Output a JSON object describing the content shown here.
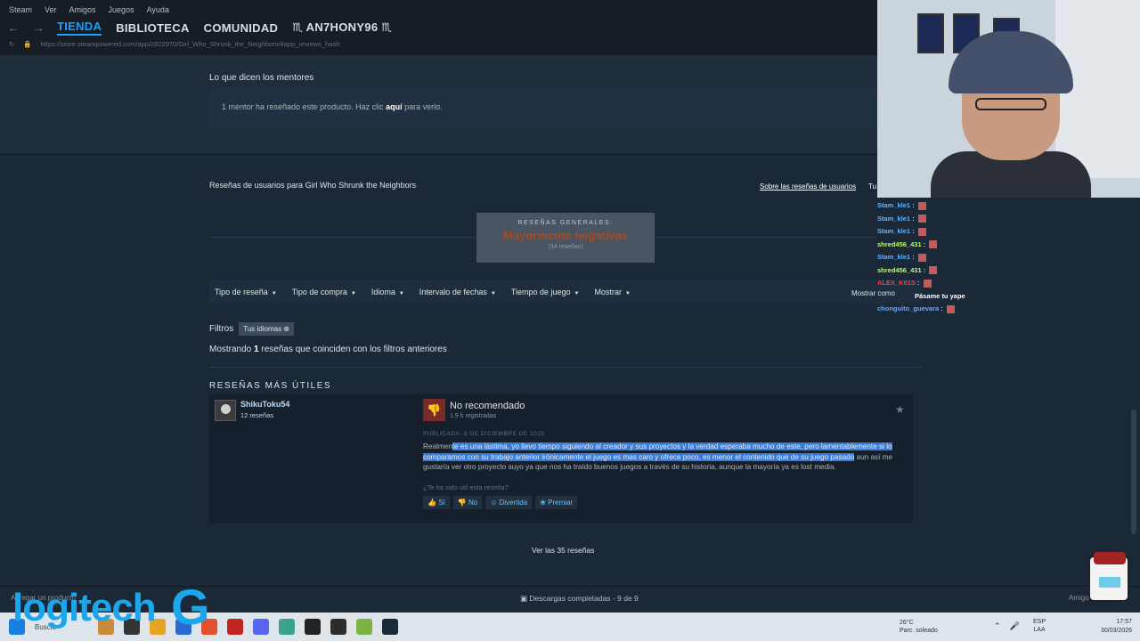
{
  "menubar": [
    "Steam",
    "Ver",
    "Amigos",
    "Juegos",
    "Ayuda"
  ],
  "nav": {
    "tabs": [
      "TIENDA",
      "BIBLIOTECA",
      "COMUNIDAD",
      "♏ AN7HONY96 ♏"
    ],
    "url": "https://store.steampowered.com/app/2822970/Girl_Who_Shrunk_the_Neighbors/#app_reviews_hash"
  },
  "mentors": {
    "title": "Lo que dicen los mentores",
    "text_before": "1 mentor ha reseñado este producto. Haz clic",
    "link": "aquí",
    "text_after": "para verlo."
  },
  "reviews": {
    "heading": "Reseñas de usuarios para Girl Who Shrunk the Neighbors",
    "about_link": "Sobre las reseñas de usuarios",
    "about_link2": "Tu",
    "summary_label": "RESEÑAS GENERALES:",
    "summary_value": "Mayormente negativas",
    "summary_count": "(34 reseñas)",
    "filters": [
      "Tipo de reseña",
      "Tipo de compra",
      "Idioma",
      "Intervalo de fechas",
      "Tiempo de juego",
      "Mostrar"
    ],
    "show_pref": "Mostrar como",
    "filtros_label": "Filtros",
    "filter_chip": "Tus idiomas",
    "showing_before": "Mostrando",
    "showing_count": "1",
    "showing_after": "reseñas que coinciden con los filtros anteriores",
    "most_helpful": "RESEÑAS MÁS ÚTILES",
    "see_all": "Ver las 35 reseñas"
  },
  "review": {
    "user": "ShikuToku54",
    "user_reviews": "12 reseñas",
    "verdict": "No recomendado",
    "hours": "1.9 h registradas",
    "posted": "PUBLICADA: 6 DE DICIEMBRE DE 2025",
    "text_plain_start": "Realmen",
    "text_highlight": "te es una lástima, yo llevo tiempo siguiendo al creador y sus proyectos y la verdad esperaba mucho de este, pero lamentablemente si lo comparamos con su trabajo anterior irónicamente el juego es mas caro y ofrece poco, es menor el contenido que de su juego pasado",
    "text_plain_end": " aun así me gustaría ver otro proyecto suyo ya que nos ha traído buenos juegos a través de su historia, aunque la mayoría ya es lost media.",
    "helpful_q": "¿Te ha sido útil esta reseña?",
    "votes": [
      "Sí",
      "No",
      "Divertida",
      "Premiar"
    ]
  },
  "footer": {
    "add_game": "Agregar un producto",
    "downloads": "Descargas completadas - 9 de 9",
    "friends": "Amigos"
  },
  "chat": [
    {
      "name": "Stam_kle1",
      "cls": "n1",
      "msg": ""
    },
    {
      "name": "Stam_kle1",
      "cls": "n1",
      "msg": ""
    },
    {
      "name": "Stam_kle1",
      "cls": "n1",
      "msg": ""
    },
    {
      "name": "shred456_431",
      "cls": "n2",
      "msg": ""
    },
    {
      "name": "Stam_kle1",
      "cls": "n1",
      "msg": ""
    },
    {
      "name": "shred456_431",
      "cls": "n2",
      "msg": ""
    },
    {
      "name": "ALEX_K01S",
      "cls": "n3",
      "msg": ""
    },
    {
      "name": "",
      "cls": "n1",
      "msg": "Pásame tu yape"
    },
    {
      "name": "chonguito_guevara",
      "cls": "n4",
      "msg": ""
    }
  ],
  "watermark": {
    "brand": "logitech",
    "g": "G"
  },
  "taskbar": {
    "search": "Buscar",
    "weather_temp": "26°C",
    "weather_desc": "Parc. soleado",
    "lang1": "ESP",
    "lang2": "LAA",
    "time": "17:57",
    "date": "30/03/2026"
  },
  "colors": {
    "accent": "#1a9fff",
    "negative": "#a34c25",
    "highlight": "#3a7bd5"
  }
}
